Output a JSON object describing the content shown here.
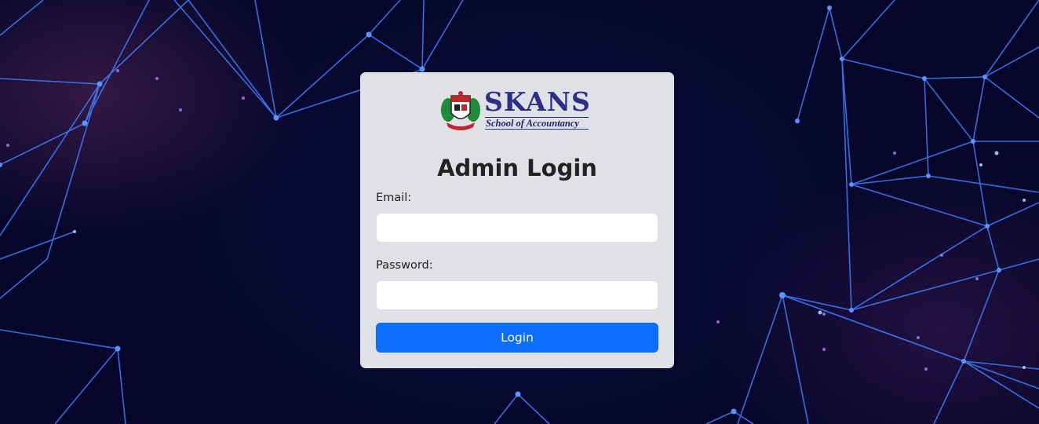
{
  "logo": {
    "brand": "SKANS",
    "tagline": "School of Accountancy"
  },
  "login": {
    "title": "Admin Login",
    "email_label": "Email:",
    "email_value": "",
    "password_label": "Password:",
    "password_value": "",
    "submit_label": "Login"
  },
  "colors": {
    "primary_button": "#0d6efd",
    "brand_text": "#2b2f86",
    "background": "#05062a",
    "network_lines": "#3a7bff"
  }
}
